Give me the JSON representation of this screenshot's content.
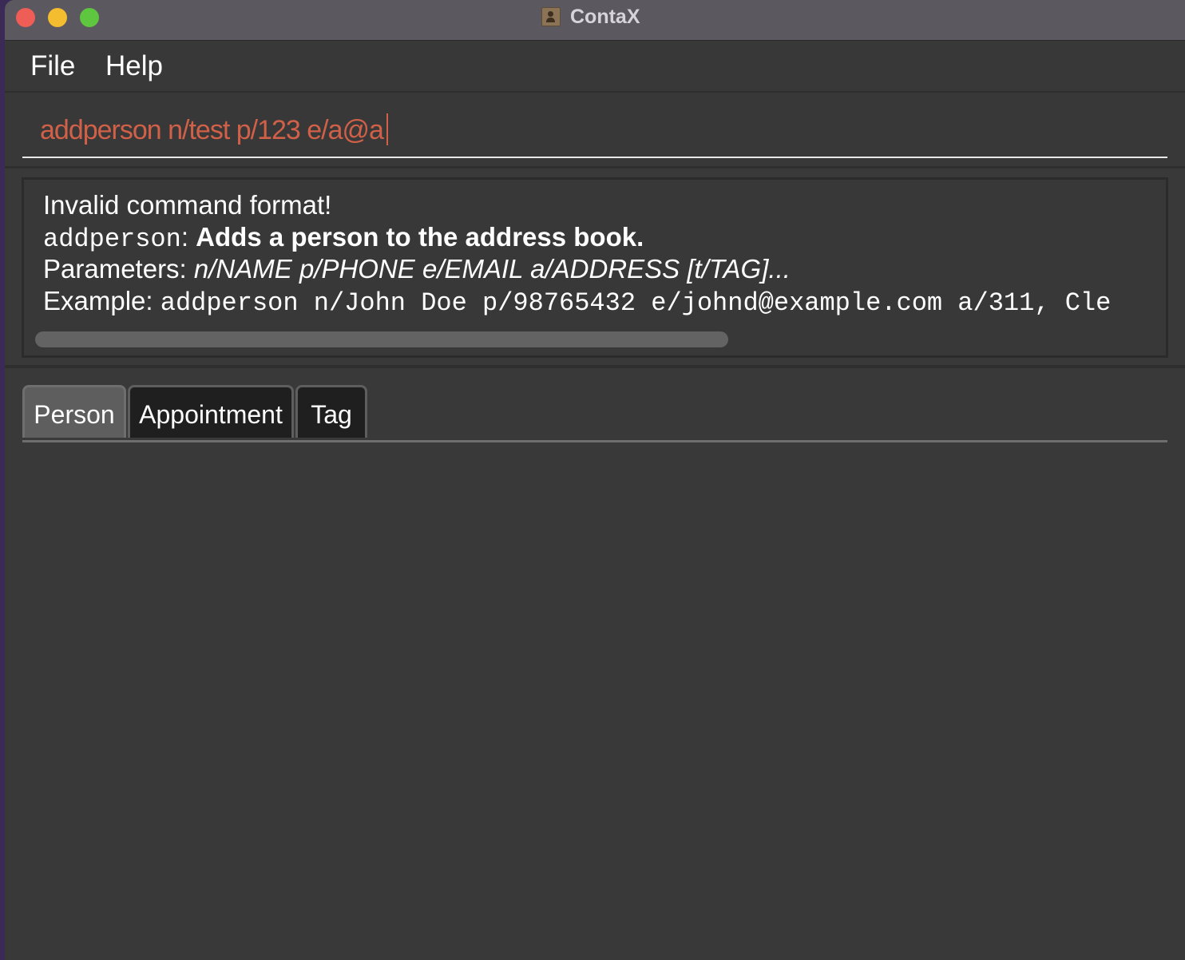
{
  "window": {
    "title": "ContaX",
    "app_icon": "contacts-book-icon"
  },
  "menubar": {
    "items": [
      "File",
      "Help"
    ]
  },
  "command": {
    "value": "addperson n/test p/123 e/a@a"
  },
  "result": {
    "line1": "Invalid command format!",
    "line2_cmd": "addperson",
    "line2_sep": ": ",
    "line2_desc": "Adds a person to the address book.",
    "line3_label": "Parameters: ",
    "line3_params": "n/NAME p/PHONE e/EMAIL a/ADDRESS [t/TAG]...",
    "line4_label": "Example: ",
    "line4_example": "addperson n/John Doe p/98765432 e/johnd@example.com a/311, Cle"
  },
  "tabs": {
    "items": [
      {
        "label": "Person",
        "active": true
      },
      {
        "label": "Appointment",
        "active": false
      },
      {
        "label": "Tag",
        "active": false
      }
    ]
  },
  "colors": {
    "background": "#393939",
    "command_text": "#d06148",
    "titlebar": "#5b5860"
  }
}
